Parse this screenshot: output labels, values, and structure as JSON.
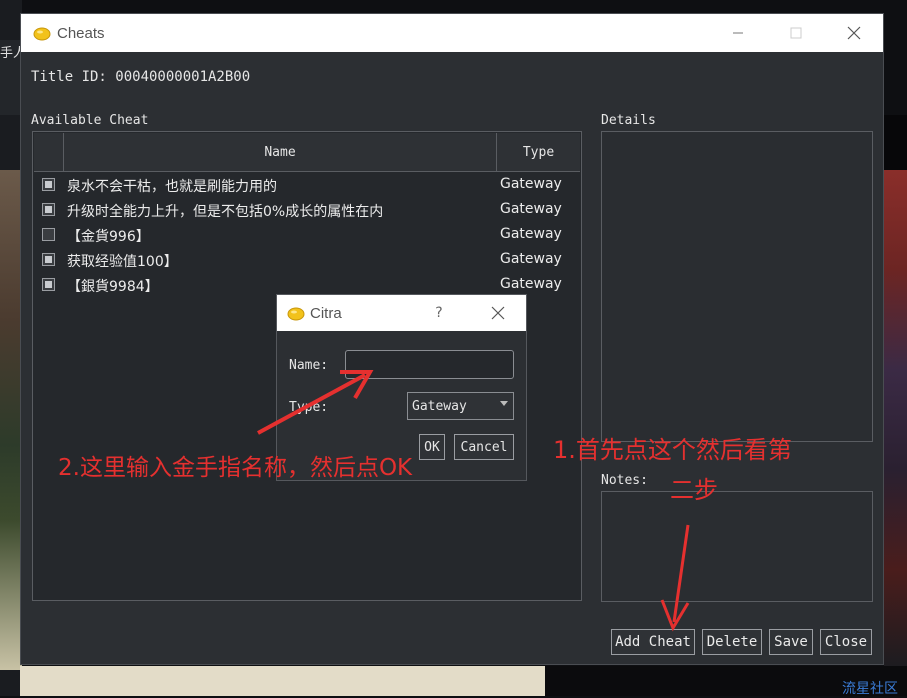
{
  "background": {
    "left_glyph": "手人",
    "watermark": "流星社区"
  },
  "cheats_window": {
    "title": "Cheats",
    "title_id_label": "Title ID: 00040000001A2B00",
    "available_label": "Available Cheat",
    "details_label": "Details",
    "notes_label": "Notes:",
    "columns": {
      "name": "Name",
      "type": "Type"
    },
    "rows": [
      {
        "name": "泉水不会干枯，也就是刷能力用的",
        "type": "Gateway",
        "checked": true
      },
      {
        "name": "升级时全能力上升，但是不包括0%成长的属性在内",
        "type": "Gateway",
        "checked": true
      },
      {
        "name": "【金貨996】",
        "type": "Gateway",
        "checked": false
      },
      {
        "name": "获取经验值100】",
        "type": "Gateway",
        "checked": true
      },
      {
        "name": "【銀貨9984】",
        "type": "Gateway",
        "checked": true
      }
    ],
    "buttons": {
      "add": "Add Cheat",
      "delete": "Delete",
      "save": "Save",
      "close": "Close"
    }
  },
  "citra_dialog": {
    "title": "Citra",
    "help": "?",
    "name_label": "Name:",
    "name_value": "",
    "type_label": "Type:",
    "type_value": "Gateway",
    "ok": "OK",
    "cancel": "Cancel"
  },
  "annotations": {
    "step1_line1": "1.首先点这个然后看第",
    "step1_line2": "二步",
    "step2": "2.这里输入金手指名称，然后点OK",
    "color": "#e5302f"
  },
  "colors": {
    "window_bg": "#2c2f33",
    "titlebar_bg": "#ffffff",
    "annotation": "#e5302f"
  }
}
